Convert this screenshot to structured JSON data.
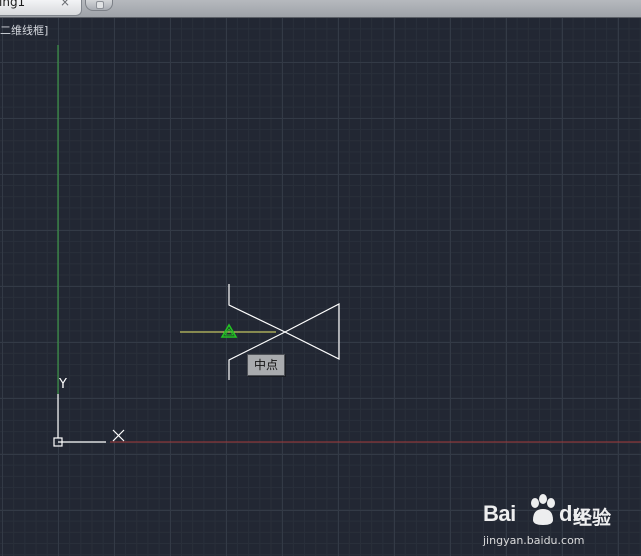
{
  "tab": {
    "title": "ing1",
    "close_glyph": "×"
  },
  "viewport": {
    "label": "二维线框]"
  },
  "ucs": {
    "y_label": "Y",
    "x_marker": "×"
  },
  "snap": {
    "tooltip": "中点",
    "marker_icon": "midpoint-triangle-icon"
  },
  "colors": {
    "background": "#222733",
    "y_axis": "#3fa84a",
    "x_axis": "#a33a3a",
    "geometry": "#ffffff",
    "tracking_line": "#e8e86a",
    "snap_marker": "#22c422"
  },
  "watermark": {
    "brand_left": "Bai",
    "brand_right": "du",
    "product": "经验",
    "url": "jingyan.baidu.com"
  }
}
